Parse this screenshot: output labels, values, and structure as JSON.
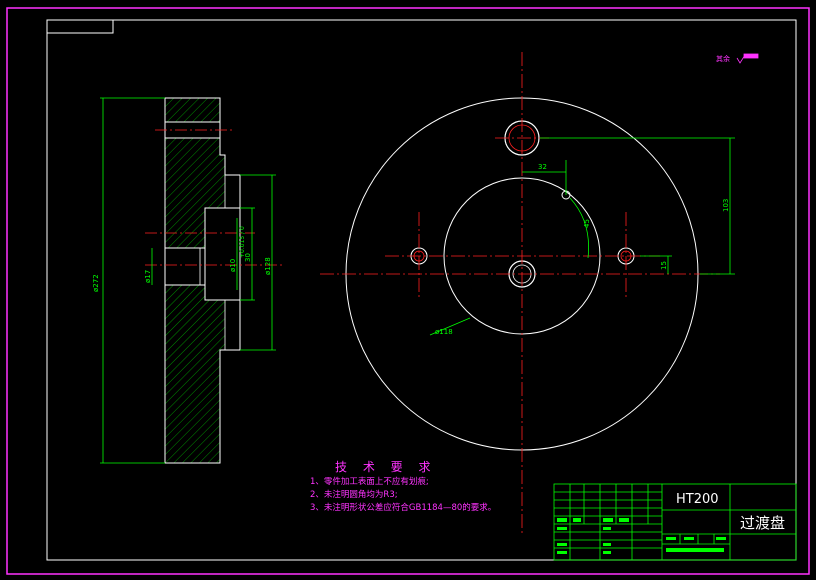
{
  "drawing": {
    "roughness_note": "其余",
    "left_view": {
      "dims": [
        "ø272",
        "ø128",
        "30",
        "ø10",
        "+0.015 / 0",
        "ø17"
      ]
    },
    "right_view": {
      "dims": [
        "32",
        "103",
        "45",
        "15",
        "ø118"
      ]
    },
    "tech_requirements": {
      "title": "技 术 要 求",
      "lines": [
        "1、零件加工表面上不应有划痕;",
        "2、未注明圆角均为R3;",
        "3、未注明形状公差应符合GB1184—80的要求。"
      ]
    },
    "title_block": {
      "material": "HT200",
      "part_name": "过渡盘"
    }
  },
  "colors": {
    "border": "#ff33ff",
    "frame": "#ffffff",
    "dimension": "#00ff00",
    "centerline": "#ff2020",
    "hatch": "#00ff00",
    "outline": "#ffffff"
  }
}
